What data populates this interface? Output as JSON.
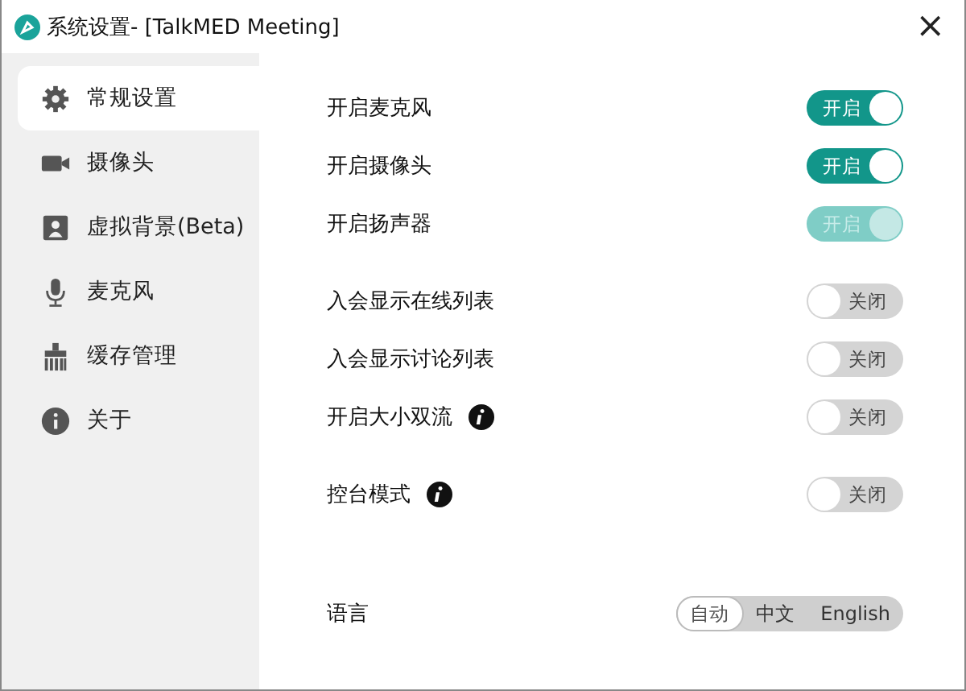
{
  "window": {
    "title": "系统设置- [TalkMED Meeting]",
    "close": "×"
  },
  "sidebar": {
    "items": [
      {
        "label": "常规设置",
        "selected": true
      },
      {
        "label": "摄像头",
        "selected": false
      },
      {
        "label": "虚拟背景(Beta)",
        "selected": false
      },
      {
        "label": "麦克风",
        "selected": false
      },
      {
        "label": "缓存管理",
        "selected": false
      },
      {
        "label": "关于",
        "selected": false
      }
    ]
  },
  "groups": [
    [
      {
        "label": "开启麦克风",
        "on": true,
        "disabled": false,
        "info": false,
        "toggle_text": "开启"
      },
      {
        "label": "开启摄像头",
        "on": true,
        "disabled": false,
        "info": false,
        "toggle_text": "开启"
      },
      {
        "label": "开启扬声器",
        "on": true,
        "disabled": true,
        "info": false,
        "toggle_text": "开启"
      }
    ],
    [
      {
        "label": "入会显示在线列表",
        "on": false,
        "disabled": false,
        "info": false,
        "toggle_text": "关闭"
      },
      {
        "label": "入会显示讨论列表",
        "on": false,
        "disabled": false,
        "info": false,
        "toggle_text": "关闭"
      },
      {
        "label": "开启大小双流",
        "on": false,
        "disabled": false,
        "info": true,
        "toggle_text": "关闭"
      }
    ],
    [
      {
        "label": "控台模式",
        "on": false,
        "disabled": false,
        "info": true,
        "toggle_text": "关闭"
      }
    ]
  ],
  "language": {
    "label": "语言",
    "options": [
      {
        "label": "自动",
        "selected": true
      },
      {
        "label": "中文",
        "selected": false
      },
      {
        "label": "English",
        "selected": false
      }
    ]
  }
}
